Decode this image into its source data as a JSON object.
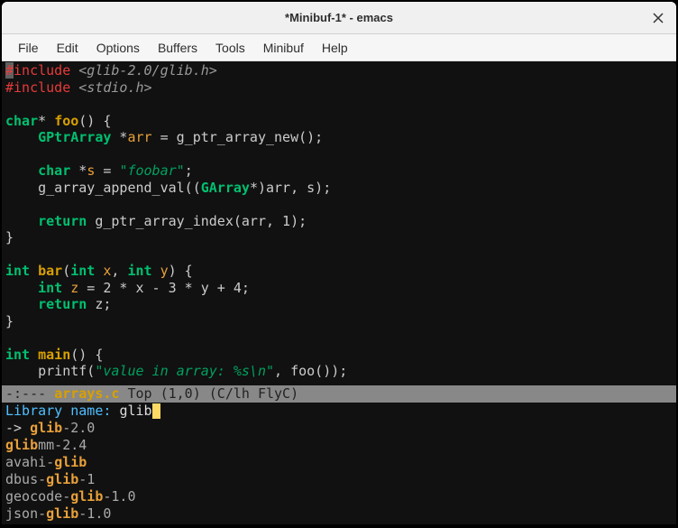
{
  "window": {
    "title": "*Minibuf-1* - emacs"
  },
  "menu": {
    "file": "File",
    "edit": "Edit",
    "options": "Options",
    "buffers": "Buffers",
    "tools": "Tools",
    "minibuf": "Minibuf",
    "help": "Help"
  },
  "code": {
    "l1_pre": "#",
    "l1_inc": "include",
    "l1_path": "<glib-2.0/glib.h>",
    "l2_pre": "#",
    "l2_inc": "include",
    "l2_path": "<stdio.h>",
    "l3": "",
    "l4_t1": "char",
    "l4_op": "*",
    "l4_fn": "foo",
    "l4_rest": "() {",
    "l5_sp": "    ",
    "l5_t": "GPtrArray",
    "l5_op": " *",
    "l5_v": "arr",
    "l5_r": " = g_ptr_array_new();",
    "l6": "",
    "l7_sp": "    ",
    "l7_t": "char",
    "l7_op": " *",
    "l7_v": "s",
    "l7_eq": " = ",
    "l7_s": "\"foobar\"",
    "l7_semi": ";",
    "l8_sp": "    ",
    "l8_a": "g_array_append_val((",
    "l8_t": "GArray",
    "l8_b": "*)arr, s);",
    "l9": "",
    "l10_sp": "    ",
    "l10_kw": "return",
    "l10_r": " g_ptr_array_index(arr, 1);",
    "l11": "}",
    "l12": "",
    "l13_t": "int",
    "l13_sp": " ",
    "l13_fn": "bar",
    "l13_a": "(",
    "l13_t2": "int",
    "l13_sp2": " ",
    "l13_v1": "x",
    "l13_c": ", ",
    "l13_t3": "int",
    "l13_sp3": " ",
    "l13_v2": "y",
    "l13_b": ") {",
    "l14_sp": "    ",
    "l14_t": "int",
    "l14_sp2": " ",
    "l14_v": "z",
    "l14_r": " = 2 * x - 3 * y + 4;",
    "l15_sp": "    ",
    "l15_kw": "return",
    "l15_r": " z;",
    "l16": "}",
    "l17": "",
    "l18_t": "int",
    "l18_sp": " ",
    "l18_fn": "main",
    "l18_r": "() {",
    "l19_sp": "    ",
    "l19_a": "printf(",
    "l19_s": "\"value in array: %s\\n\"",
    "l19_b": ", foo());"
  },
  "modeline": {
    "left": "-:---  ",
    "filename": "arrays.c",
    "mid": "      Top (1,0)      (C/lh FlyC)"
  },
  "minibuf": {
    "prompt": "Library name: ",
    "input": "glib",
    "candidates": [
      {
        "arrow": "-> ",
        "pre": "",
        "hl": "glib",
        "post": "-2.0"
      },
      {
        "arrow": "   ",
        "pre": "",
        "hl": "glib",
        "post": "mm-2.4"
      },
      {
        "arrow": "   ",
        "pre": "avahi-",
        "hl": "glib",
        "post": ""
      },
      {
        "arrow": "   ",
        "pre": "dbus-",
        "hl": "glib",
        "post": "-1"
      },
      {
        "arrow": "   ",
        "pre": "geocode-",
        "hl": "glib",
        "post": "-1.0"
      },
      {
        "arrow": "   ",
        "pre": "json-",
        "hl": "glib",
        "post": "-1.0"
      }
    ]
  }
}
